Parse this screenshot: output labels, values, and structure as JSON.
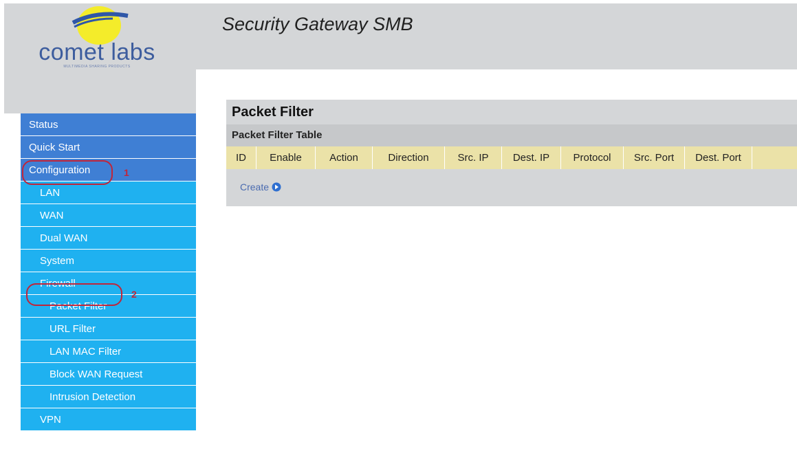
{
  "header": {
    "brand": "comet labs",
    "brand_tagline": "MULTIMEDIA SHARING PRODUCTS",
    "app_title": "Security Gateway SMB"
  },
  "sidebar": {
    "items": [
      {
        "label": "Status",
        "level": 1
      },
      {
        "label": "Quick Start",
        "level": 1
      },
      {
        "label": "Configuration",
        "level": 1
      },
      {
        "label": "LAN",
        "level": 2
      },
      {
        "label": "WAN",
        "level": 2
      },
      {
        "label": "Dual WAN",
        "level": 2
      },
      {
        "label": "System",
        "level": 2
      },
      {
        "label": "Firewall",
        "level": 2
      },
      {
        "label": "Packet Filter",
        "level": 3
      },
      {
        "label": "URL Filter",
        "level": 3
      },
      {
        "label": "LAN MAC Filter",
        "level": 3
      },
      {
        "label": "Block WAN Request",
        "level": 3
      },
      {
        "label": "Intrusion Detection",
        "level": 3
      },
      {
        "label": "VPN",
        "level": 2
      }
    ]
  },
  "annotations": {
    "mark1": "1",
    "mark2": "2"
  },
  "main": {
    "page_title": "Packet Filter",
    "section_title": "Packet Filter Table",
    "columns": [
      "ID",
      "Enable",
      "Action",
      "Direction",
      "Src. IP",
      "Dest. IP",
      "Protocol",
      "Src. Port",
      "Dest. Port"
    ],
    "create_label": "Create"
  },
  "colors": {
    "nav_top": "#3f7fd4",
    "nav_sub": "#1fb1f0",
    "table_header": "#ebe2a8",
    "annotation": "#c0253a"
  },
  "icons": {
    "logo": "comet-logo-icon",
    "create": "arrow-right-circle-icon"
  }
}
